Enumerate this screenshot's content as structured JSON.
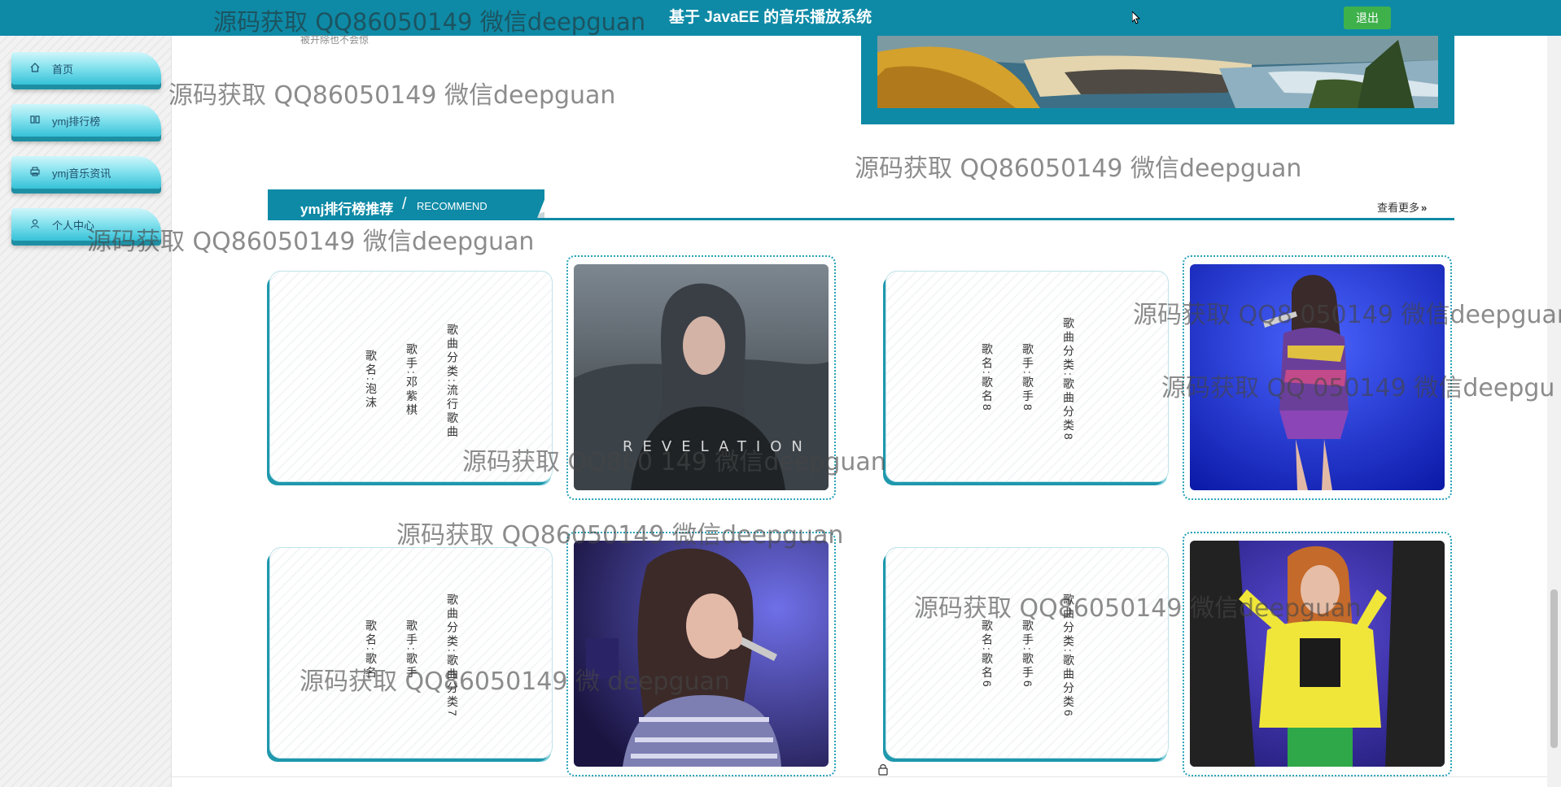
{
  "header": {
    "title": "基于 JavaEE 的音乐播放系统",
    "logout_label": "退出",
    "bg_color": "#0e8aa6"
  },
  "sidebar": {
    "items": [
      {
        "label": "首页",
        "icon": "home-icon"
      },
      {
        "label": "ymj排行榜",
        "icon": "columns-icon"
      },
      {
        "label": "ymj音乐资讯",
        "icon": "printer-icon"
      },
      {
        "label": "个人中心",
        "icon": "user-icon"
      }
    ]
  },
  "news_snippet": "被开除也不会惊",
  "section": {
    "title": "ymj排行榜推荐",
    "separator": "/",
    "subtitle": "RECOMMEND",
    "more_label": "查看更多",
    "more_chevron": "»"
  },
  "songs": [
    {
      "name": "歌名:泡沫",
      "singer": "歌手:邓紫棋",
      "category": "歌曲分类:流行歌曲",
      "image": "singer-photo-revelation"
    },
    {
      "name": "歌名:歌名8",
      "singer": "歌手:歌手8",
      "category": "歌曲分类:歌曲分类8",
      "image": "singer-photo-stage-blue"
    },
    {
      "name": "歌名:歌名",
      "singer": "歌手:歌手",
      "category": "歌曲分类:歌曲分类7",
      "image": "singer-photo-microphone"
    },
    {
      "name": "歌名:歌名6",
      "singer": "歌手:歌手6",
      "category": "歌曲分类:歌曲分类6",
      "image": "singer-photo-yellow-jacket"
    }
  ],
  "watermark_text": "源码获取 QQ86050149 微信deepguan",
  "watermark_variants": [
    "源码获取 QQ8 050149 微信deepguan",
    "源码获取 QQ  050149 微信deepgu",
    "源码获取 QQ860 149 微信deepguan",
    "源码获取 QQ86050149 微信deepguan",
    "源码获取 QQ86050149 微信deepguan",
    "源码获取 QQ86050149 微 deepguan"
  ]
}
